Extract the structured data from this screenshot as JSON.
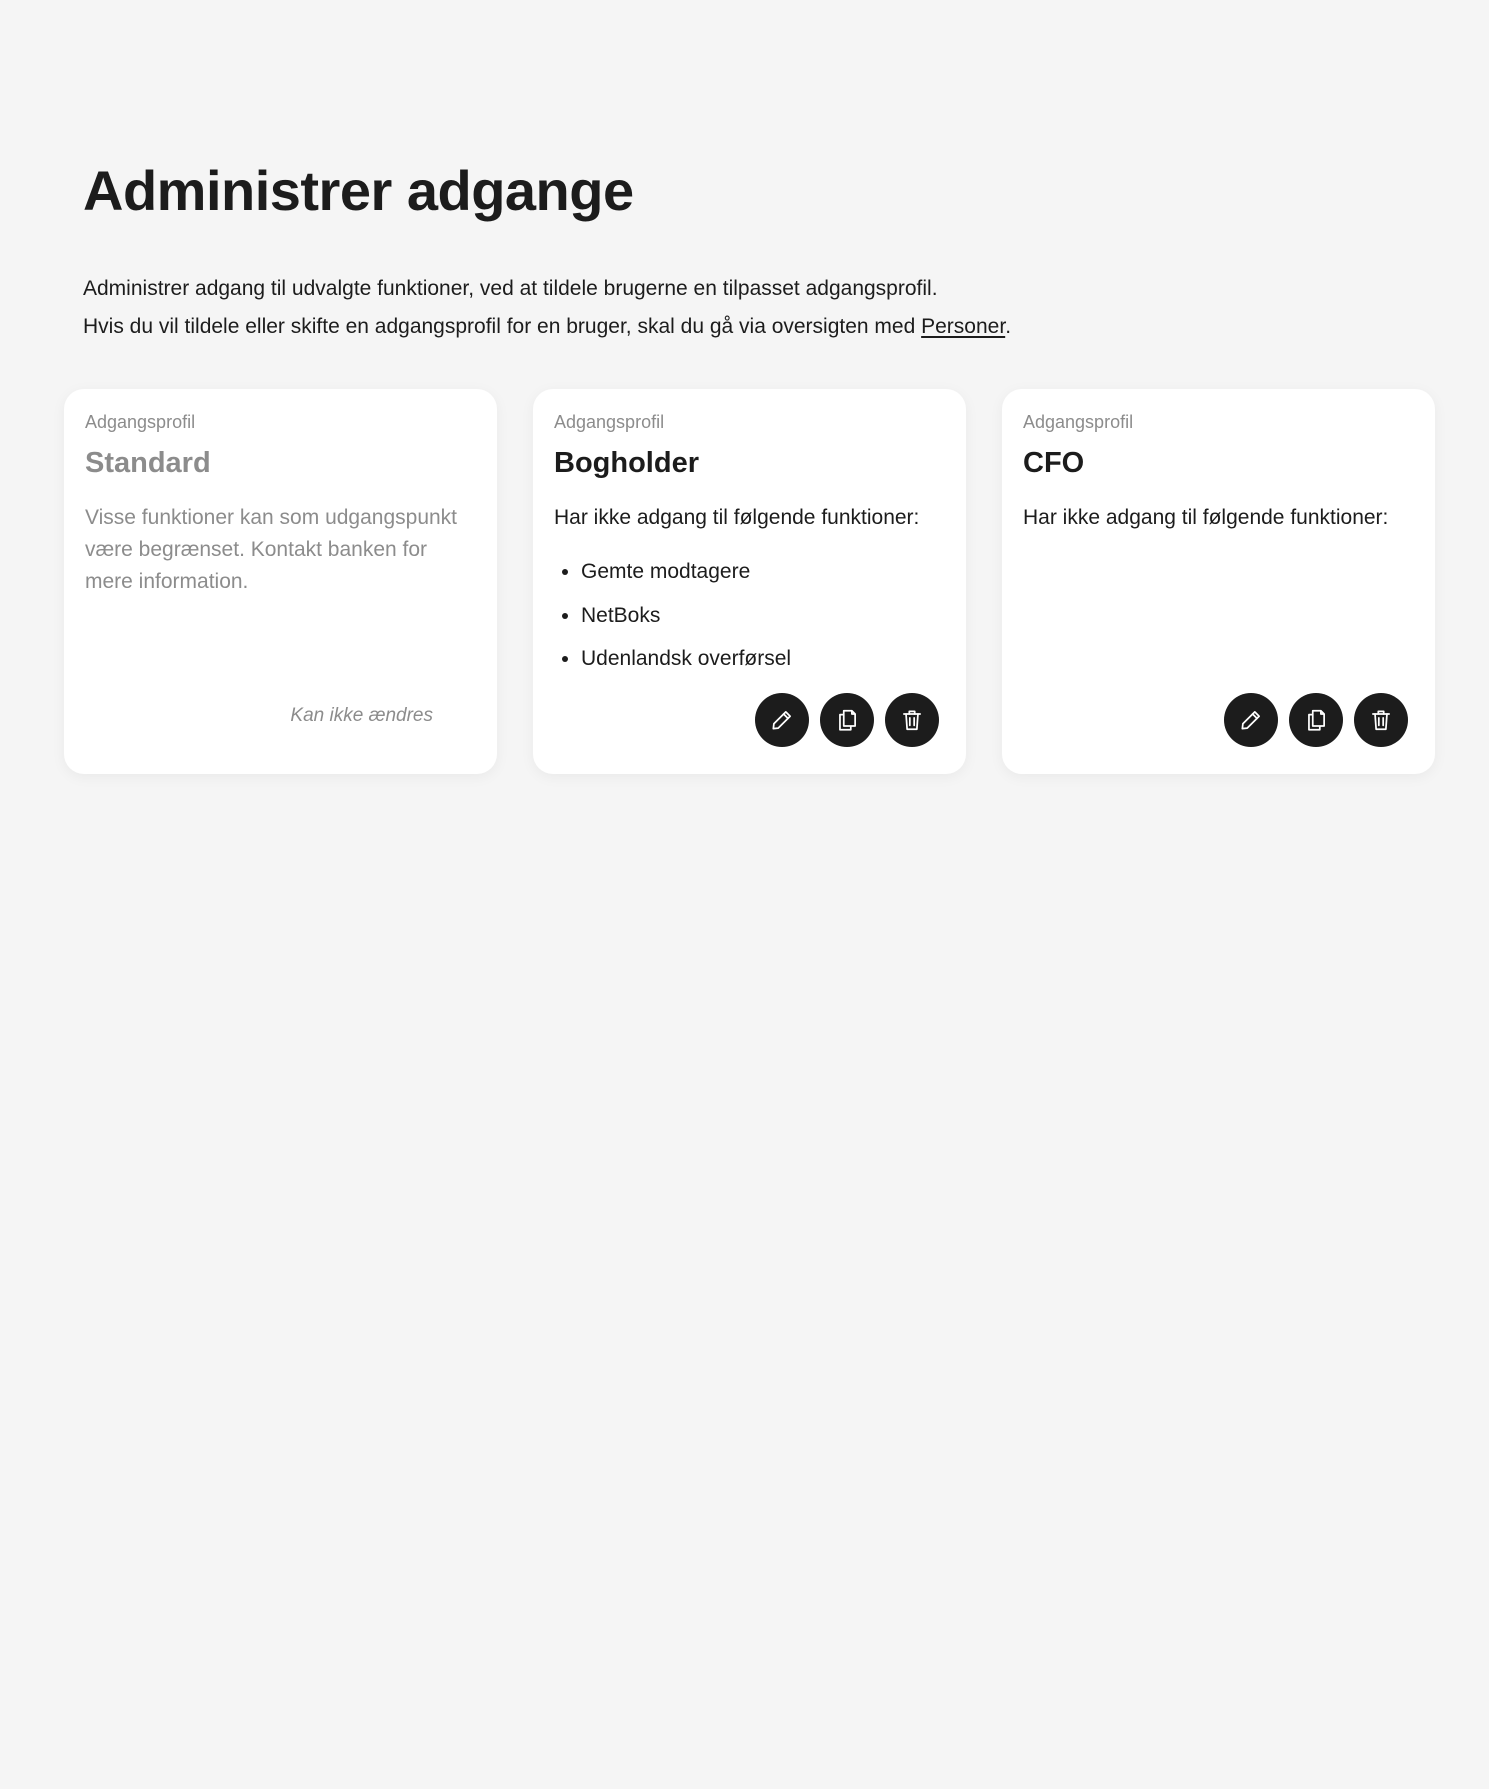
{
  "page": {
    "title": "Administrer adgange",
    "intro_line1": "Administrer adgang til udvalgte funktioner, ved at tildele brugerne en tilpasset adgangsprofil.",
    "intro_line2_prefix": "Hvis du vil tildele eller skifte en adgangsprofil for en bruger, skal du gå via oversigten med ",
    "intro_link": "Personer",
    "intro_line2_suffix": "."
  },
  "cards": [
    {
      "kicker": "Adgangsprofil",
      "title": "Standard",
      "description": "Visse funktioner kan som udgangspunkt være begrænset. Kontakt banken for mere information.",
      "locked_note": "Kan ikke ændres"
    },
    {
      "kicker": "Adgangsprofil",
      "title": "Bogholder",
      "description": "Har ikke adgang til følgende funktioner:",
      "restrictions": [
        "Gemte modtagere",
        "NetBoks",
        "Udenlandsk overførsel"
      ],
      "actions": {
        "edit_icon": "pencil-icon",
        "copy_icon": "copy-icon",
        "delete_icon": "trash-icon"
      }
    },
    {
      "kicker": "Adgangsprofil",
      "title": "CFO",
      "description": "Har ikke adgang til følgende funktioner:",
      "restrictions": [],
      "actions": {
        "edit_icon": "pencil-icon",
        "copy_icon": "copy-icon",
        "delete_icon": "trash-icon"
      }
    }
  ],
  "colors": {
    "background": "#f5f5f5",
    "card": "#ffffff",
    "text": "#1c1c1c",
    "muted": "#8c8c8c",
    "button": "#1c1c1c"
  }
}
